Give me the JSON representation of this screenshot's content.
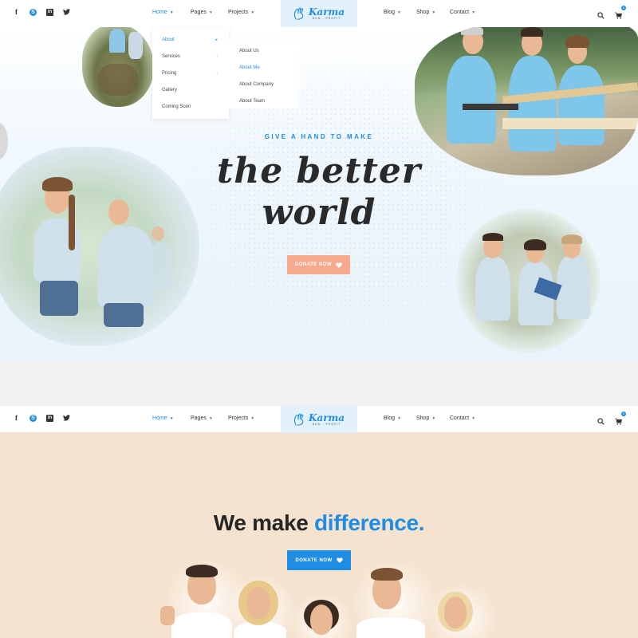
{
  "header": {
    "social": [
      {
        "icon": "facebook-icon",
        "glyph": "f"
      },
      {
        "icon": "skype-icon",
        "glyph": "S"
      },
      {
        "icon": "linkedin-icon",
        "glyph": "in"
      },
      {
        "icon": "twitter-icon",
        "glyph": "🐦"
      }
    ],
    "nav_left": [
      "Home",
      "Pages",
      "Projects"
    ],
    "nav_right": [
      "Blog",
      "Shop",
      "Contact"
    ],
    "logo": {
      "name": "Karma",
      "tagline": "NON - PROFIT"
    },
    "cart_count": "0"
  },
  "dropdown": {
    "items": [
      "About",
      "Services",
      "Pricing",
      "Gallery",
      "Coming Soon"
    ],
    "submenu": [
      "About Us",
      "About Me",
      "About Company",
      "About Team"
    ]
  },
  "hero": {
    "kicker": "GIVE A HAND TO MAKE",
    "title_line1": "the better",
    "title_line2": "world",
    "donate_label": "DONATE NOW"
  },
  "section2": {
    "title_plain": "We make",
    "title_accent": "difference.",
    "donate_label": "DONATE NOW"
  },
  "colors": {
    "accent": "#1f8de3",
    "hero_button": "#f6a98d",
    "peach_bg": "#f6e3cf"
  }
}
